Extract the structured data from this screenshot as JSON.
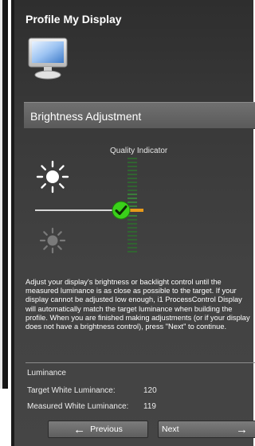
{
  "panel": {
    "title": "Profile My Display",
    "section_title": "Brightness Adjustment",
    "quality_indicator_label": "Quality Indicator",
    "description": "Adjust your display's brightness or backlight control until the measured luminance is as close as possible to the target.  If your display cannot be adjusted low enough, i1 ProcessControl Display will automatically match the target luminance when building the profile.  When you are finished making adjustments (or if your display does not have a brightness control), press \"Next\" to continue."
  },
  "luminance": {
    "heading": "Luminance",
    "target_label": "Target White Luminance:",
    "target_value": "120",
    "measured_label": "Measured White Luminance:",
    "measured_value": "119"
  },
  "nav": {
    "previous_label": "Previous",
    "next_label": "Next"
  },
  "icons": {
    "monitor": "monitor-icon",
    "bright_sun": "bright-sun-icon",
    "dim_sun": "dim-sun-icon",
    "check": "check-icon",
    "prev_arrow": "arrow-left-icon",
    "next_arrow": "arrow-right-icon"
  },
  "colors": {
    "panel_bg": "#3e3e3e",
    "section_bar": "#666666",
    "check_green": "#3ad11a",
    "marker_orange": "#e89a1a",
    "quality_green": "#2f6b2f"
  }
}
